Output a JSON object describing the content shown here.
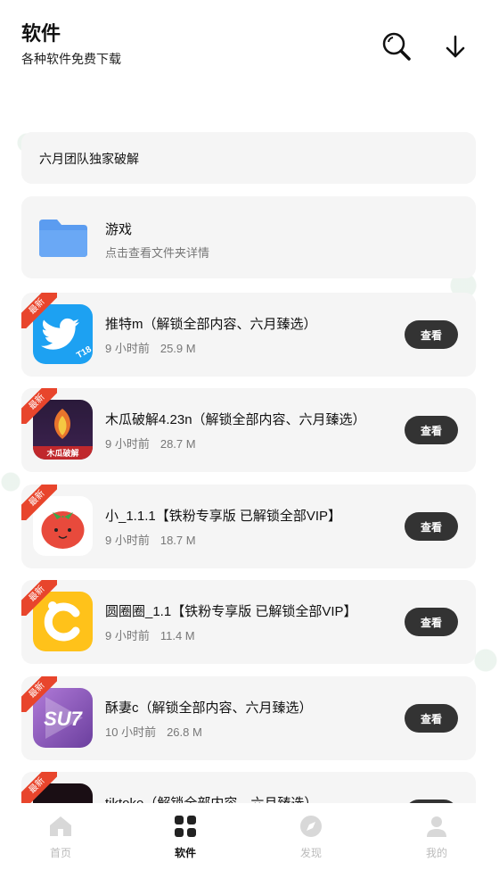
{
  "header": {
    "title": "软件",
    "subtitle": "各种软件免费下载"
  },
  "banner": {
    "text": "六月团队独家破解"
  },
  "folder": {
    "name": "游戏",
    "desc": "点击查看文件夹详情"
  },
  "badge_label": "最新",
  "view_label": "查看",
  "apps": [
    {
      "name": "推特m（解锁全部内容、六月臻选）",
      "time": "9 小时前",
      "size": "25.9 M",
      "icon": "twitter-icon"
    },
    {
      "name": "木瓜破解4.23n（解锁全部内容、六月臻选）",
      "time": "9 小时前",
      "size": "28.7 M",
      "icon": "papaya-icon"
    },
    {
      "name": "小_1.1.1【铁粉专享版 已解锁全部VIP】",
      "time": "9 小时前",
      "size": "18.7 M",
      "icon": "tomato-icon"
    },
    {
      "name": "圆圈圈_1.1【铁粉专享版 已解锁全部VIP】",
      "time": "9 小时前",
      "size": "11.4 M",
      "icon": "circle-c-icon"
    },
    {
      "name": "酥妻c（解锁全部内容、六月臻选）",
      "time": "10 小时前",
      "size": "26.8 M",
      "icon": "su7-icon"
    },
    {
      "name": "tiktoke（解锁全部内容、六月臻选）",
      "time": "",
      "size": "",
      "icon": "tiktok-icon"
    }
  ],
  "tabs": [
    {
      "label": "首页",
      "icon": "home-icon",
      "active": false
    },
    {
      "label": "软件",
      "icon": "grid-icon",
      "active": true
    },
    {
      "label": "发现",
      "icon": "compass-icon",
      "active": false
    },
    {
      "label": "我的",
      "icon": "user-icon",
      "active": false
    }
  ],
  "colors": {
    "accent": "#333333",
    "badge": "#e8452c",
    "folder": "#5b9cf0"
  }
}
